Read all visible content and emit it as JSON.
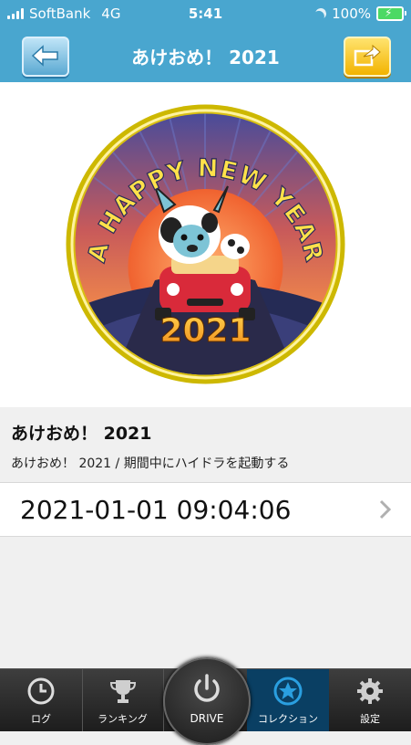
{
  "status": {
    "carrier": "SoftBank",
    "network": "4G",
    "time": "5:41",
    "battery": "100%"
  },
  "nav": {
    "title": "あけおめ！ 2021"
  },
  "badge": {
    "arc_text": "A HAPPY NEW YEAR",
    "year": "2021"
  },
  "info": {
    "title": "あけおめ！ 2021",
    "description": "あけおめ！ 2021 / 期間中にハイドラを起動する"
  },
  "entry": {
    "datetime": "2021-01-01 09:04:06"
  },
  "tabs": {
    "log": "ログ",
    "ranking": "ランキング",
    "drive": "DRIVE",
    "collection": "コレクション",
    "settings": "設定"
  },
  "colors": {
    "header": "#49a6cf",
    "accent": "#2a9fe0",
    "tab_active": "#0a3f63",
    "share_button": "#f2b300"
  }
}
